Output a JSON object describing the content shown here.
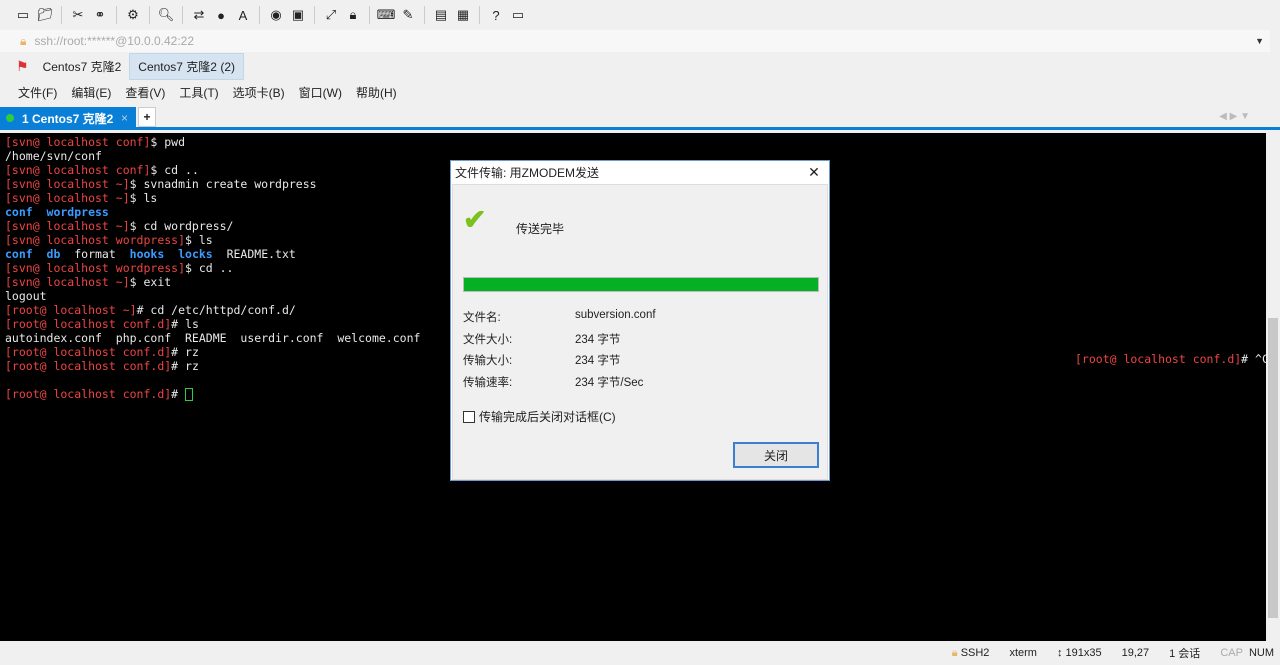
{
  "toolbar": {
    "icons": [
      "new-session-icon",
      "open-folder-icon",
      "disconnect-icon",
      "reconnect-icon",
      "session-properties-icon",
      "find-icon",
      "transfer-icon",
      "globe-icon",
      "font-icon",
      "xshell-icon",
      "xftp-icon",
      "fullscreen-icon",
      "lock-icon",
      "keyboard-icon",
      "highlight-icon",
      "new-tab-group-icon",
      "layout-icon",
      "help-icon",
      "chat-icon"
    ]
  },
  "address": {
    "value": "ssh://root:******@10.0.0.42:22"
  },
  "sessions": [
    {
      "label": "Centos7 克隆2"
    },
    {
      "label": "Centos7 克隆2 (2)"
    }
  ],
  "menu": [
    "文件(F)",
    "编辑(E)",
    "查看(V)",
    "工具(T)",
    "选项卡(B)",
    "窗口(W)",
    "帮助(H)"
  ],
  "tab": {
    "label": "1 Centos7 克隆2",
    "close": "×",
    "add": "+"
  },
  "terminal": {
    "lines": [
      [
        [
          "[svn@ localhost conf]",
          "r"
        ],
        [
          "$ pwd",
          "w"
        ]
      ],
      [
        [
          "/home/svn/conf",
          "w"
        ]
      ],
      [
        [
          "[svn@ localhost conf]",
          "r"
        ],
        [
          "$ cd ..",
          "w"
        ]
      ],
      [
        [
          "[svn@ localhost ~]",
          "r"
        ],
        [
          "$ svnadmin create wordpress",
          "w"
        ]
      ],
      [
        [
          "[svn@ localhost ~]",
          "r"
        ],
        [
          "$ ls",
          "w"
        ]
      ],
      [
        [
          "conf  wordpress",
          "b"
        ]
      ],
      [
        [
          "[svn@ localhost ~]",
          "r"
        ],
        [
          "$ cd wordpress/",
          "w"
        ]
      ],
      [
        [
          "[svn@ localhost wordpress]",
          "r"
        ],
        [
          "$ ls",
          "w"
        ]
      ],
      [
        [
          "conf  db",
          "b"
        ],
        [
          "  format  ",
          "w"
        ],
        [
          "hooks  locks",
          "b"
        ],
        [
          "  README.txt",
          "w"
        ]
      ],
      [
        [
          "[svn@ localhost wordpress]",
          "r"
        ],
        [
          "$ cd ..",
          "w"
        ]
      ],
      [
        [
          "[svn@ localhost ~]",
          "r"
        ],
        [
          "$ exit",
          "w"
        ]
      ],
      [
        [
          "logout",
          "w"
        ]
      ],
      [
        [
          "[root@ localhost ~]",
          "r"
        ],
        [
          "# cd /etc/httpd/conf.d/",
          "w"
        ]
      ],
      [
        [
          "[root@ localhost conf.d]",
          "r"
        ],
        [
          "# ls",
          "w"
        ]
      ],
      [
        [
          "autoindex.conf  php.conf  README  userdir.conf  welcome.conf",
          "w"
        ]
      ],
      [
        [
          "[root@ localhost conf.d]",
          "r"
        ],
        [
          "# rz",
          "w"
        ]
      ],
      [
        [
          "[root@ localhost conf.d]",
          "r"
        ],
        [
          "# rz",
          "w"
        ]
      ],
      [],
      [
        [
          "[root@ localhost conf.d]",
          "r"
        ],
        [
          "# ",
          "w"
        ]
      ]
    ],
    "right_prompt": "[root@ localhost conf.d]",
    "right_cmd": "# ^C"
  },
  "dialog": {
    "title": "文件传输: 用ZMODEM发送",
    "status": "传送完毕",
    "progress_percent": 100,
    "fields": [
      {
        "label": "文件名:",
        "value": "subversion.conf"
      },
      {
        "label": "文件大小:",
        "value": "234 字节"
      },
      {
        "label": "传输大小:",
        "value": "234 字节"
      },
      {
        "label": "传输速率:",
        "value": "234 字节/Sec"
      }
    ],
    "checkbox": {
      "label": "传输完成后关闭对话框(C)",
      "checked": false
    },
    "close_button": "关闭"
  },
  "status": {
    "protocol": "SSH2",
    "term": "xterm",
    "size": "191x35",
    "cursor": "19,27",
    "sessions": "1 会话",
    "cap": "CAP",
    "num": "NUM"
  },
  "colors": {
    "accent": "#0a7fd8",
    "progress": "#06b025",
    "prompt": "#ee4444",
    "dir": "#3b9bff"
  }
}
